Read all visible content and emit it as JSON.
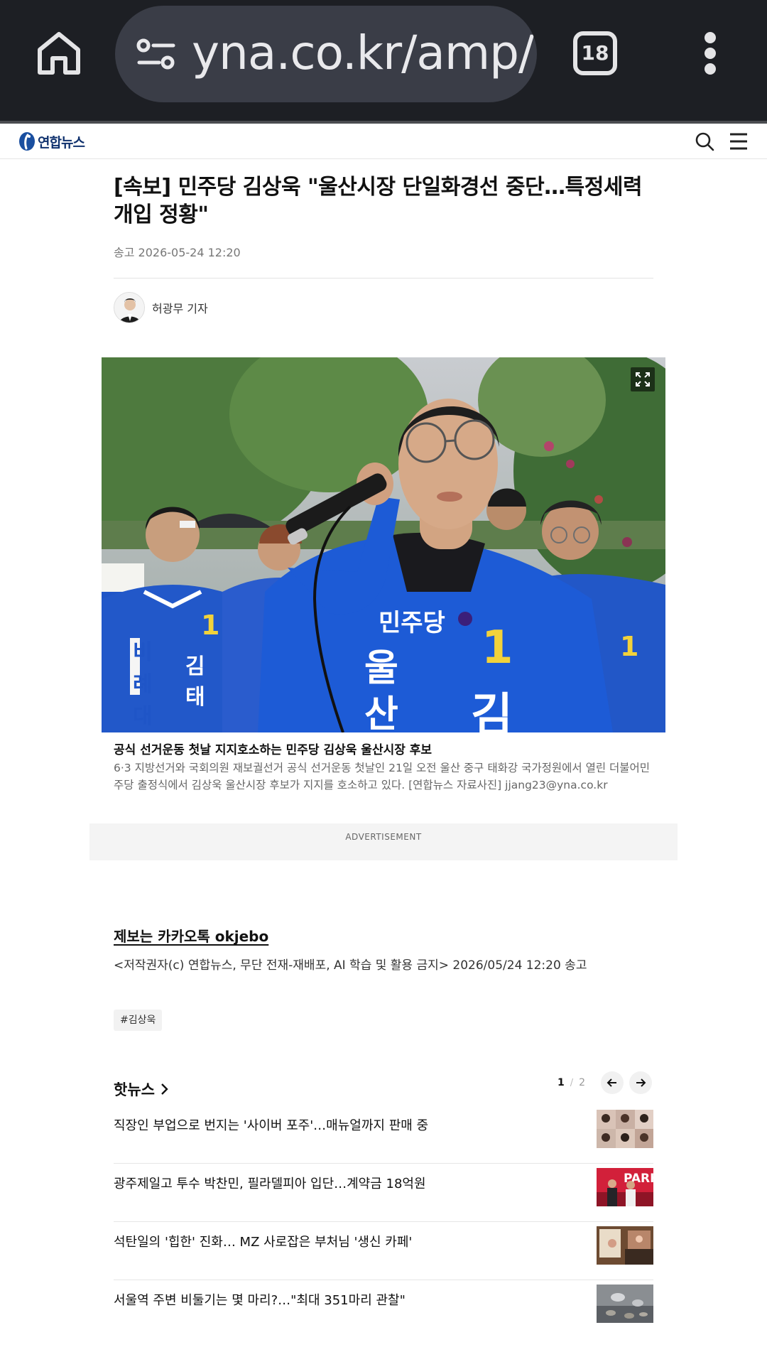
{
  "browser": {
    "url": "yna.co.kr/amp/",
    "tab_count": "18",
    "icons": [
      "home-icon",
      "site-settings-icon",
      "tabs-icon",
      "more-vert-icon"
    ]
  },
  "site": {
    "logo_text": "연합뉴스",
    "icons": [
      "search-icon",
      "hamburger-menu-icon"
    ]
  },
  "article": {
    "headline": "[속보] 민주당 김상욱 \"울산시장 단일화경선 중단…특정세력 개입 정황\"",
    "published": "송고 2026-05-24 12:20",
    "author": "허광무 기자",
    "photo": {
      "caption_title": "공식 선거운동 첫날 지지호소하는 민주당 김상욱 울산시장 후보",
      "caption_body": "6·3 지방선거와 국회의원 재보궐선거 공식 선거운동 첫날인 21일 오전 울산 중구 태화강 국가정원에서 열린 더불어민주당 출정식에서 김상욱 울산시장 후보가 지지를 호소하고 있다. [연합뉴스 자료사진] jjang23@yna.co.kr",
      "jacket_texts": [
        "민주당",
        "울산",
        "1",
        "김",
        "비례대표",
        "김태"
      ]
    },
    "ad_label": "ADVERTISEMENT",
    "tip_link": "제보는 카카오톡 okjebo",
    "copyright": "<저작권자(c) 연합뉴스, 무단 전재-재배포, AI 학습 및 활용 금지> 2026/05/24 12:20 송고",
    "tag": "#김상욱"
  },
  "hot_news": {
    "title": "핫뉴스",
    "page_current": "1",
    "page_sep": "/",
    "page_total": "2",
    "items": [
      {
        "title": "직장인 부업으로 번지는 '사이버 포주'…매뉴얼까지 판매 중"
      },
      {
        "title": "광주제일고 투수 박찬민, 필라델피아 입단…계약금 18억원",
        "thumb_text": "PARK"
      },
      {
        "title": "석탄일의 '힙한' 진화… MZ 사로잡은 부처님 '생신 카페'"
      },
      {
        "title": "서울역 주변 비둘기는 몇 마리?…\"최대 351마리 관찰\""
      }
    ]
  },
  "colors": {
    "chrome_bg": "#1d1f24",
    "url_pill": "#3a3d47",
    "brand_blue": "#10326e",
    "jacket_blue": "#1f55c7"
  }
}
